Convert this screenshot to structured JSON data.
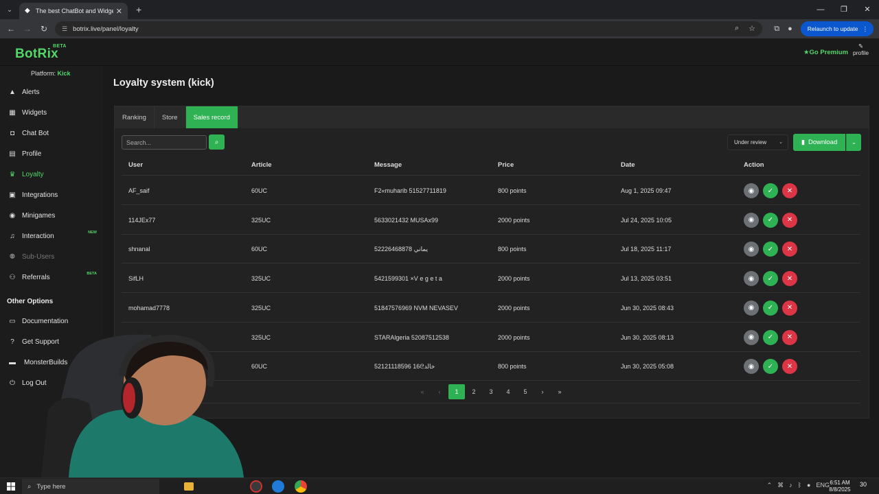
{
  "browser": {
    "tab_title": "The best ChatBot and Widgets",
    "url": "botrix.live/panel/loyalty",
    "relaunch_label": "Relaunch to update"
  },
  "header": {
    "logo": "BotRix",
    "logo_badge": "BETA",
    "go_premium": "Go Premium",
    "profile_label": "profile"
  },
  "sidebar": {
    "platform_label": "Platform:",
    "platform_value": "Kick",
    "items": [
      {
        "label": "Alerts",
        "icon": "warning-icon"
      },
      {
        "label": "Widgets",
        "icon": "grid-icon"
      },
      {
        "label": "Chat Bot",
        "icon": "robot-icon"
      },
      {
        "label": "Profile",
        "icon": "id-card-icon"
      },
      {
        "label": "Loyalty",
        "icon": "trophy-icon"
      },
      {
        "label": "Integrations",
        "icon": "list-icon"
      },
      {
        "label": "Minigames",
        "icon": "gamepad-icon"
      },
      {
        "label": "Interaction",
        "icon": "music-icon",
        "tag": "NEW"
      },
      {
        "label": "Sub-Users",
        "icon": "users-icon"
      },
      {
        "label": "Referrals",
        "icon": "users-icon",
        "tag": "BETA"
      }
    ],
    "other_title": "Other Options",
    "other_items": [
      {
        "label": "Documentation",
        "icon": "book-icon"
      },
      {
        "label": "Get Support",
        "icon": "question-icon"
      },
      {
        "label": "MonsterBuilds",
        "icon": "monitor-icon"
      },
      {
        "label": "Log Out",
        "icon": "logout-icon"
      }
    ]
  },
  "main": {
    "title": "Loyalty system (kick)",
    "tabs": [
      "Ranking",
      "Store",
      "Sales record"
    ],
    "active_tab": "Sales record",
    "search_placeholder": "Search...",
    "status_filter": "Under review",
    "download_label": "Download",
    "columns": [
      "User",
      "Article",
      "Message",
      "Price",
      "Date",
      "Action"
    ],
    "rows": [
      {
        "user": "AF_saif",
        "article": "60UC",
        "message": "F2«muharib 51527711819",
        "price": "800 points",
        "date": "Aug 1, 2025 09:47"
      },
      {
        "user": "114JEx77",
        "article": "325UC",
        "message": "5633021432 MUSAx99",
        "price": "2000 points",
        "date": "Jul 24, 2025 10:05"
      },
      {
        "user": "shnanal",
        "article": "60UC",
        "message": "52226468878 يماني",
        "price": "800 points",
        "date": "Jul 18, 2025 11:17"
      },
      {
        "user": "SifLH",
        "article": "325UC",
        "message": "5421599301 ×V e g e t a",
        "price": "2000 points",
        "date": "Jul 13, 2025 03:51"
      },
      {
        "user": "mohamad7778",
        "article": "325UC",
        "message": "51847576969 NVM NEVASEV",
        "price": "2000 points",
        "date": "Jun 30, 2025 08:43"
      },
      {
        "user": "",
        "article": "325UC",
        "message": "STARAlgeria 52087512538",
        "price": "2000 points",
        "date": "Jun 30, 2025 08:13"
      },
      {
        "user": "",
        "article": "60UC",
        "message": "52121118596 16ᘓخالد",
        "price": "800 points",
        "date": "Jun 30, 2025 05:08"
      }
    ],
    "pages": [
      "1",
      "2",
      "3",
      "4",
      "5"
    ],
    "current_page": "1"
  },
  "taskbar": {
    "search_placeholder": "Type here",
    "language": "ENG",
    "time": "6:51 AM",
    "date": "8/8/2025",
    "notifications": "30"
  }
}
